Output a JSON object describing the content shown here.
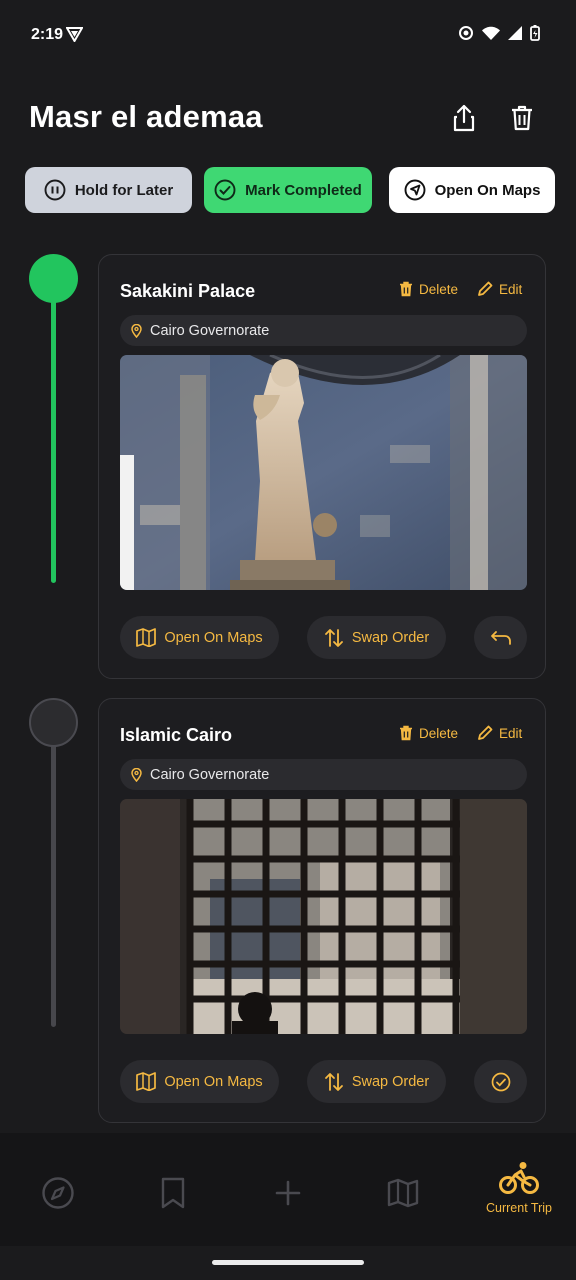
{
  "status": {
    "time": "2:19"
  },
  "header": {
    "title": "Masr el ademaa"
  },
  "actions": {
    "hold": "Hold for Later",
    "complete": "Mark Completed",
    "maps": "Open On Maps"
  },
  "stops": [
    {
      "title": "Sakakini Palace",
      "location": "Cairo Governorate",
      "delete_label": "Delete",
      "edit_label": "Edit",
      "maps_label": "Open On Maps",
      "swap_label": "Swap Order"
    },
    {
      "title": "Islamic Cairo",
      "location": "Cairo Governorate",
      "delete_label": "Delete",
      "edit_label": "Edit",
      "maps_label": "Open On Maps",
      "swap_label": "Swap Order"
    }
  ],
  "nav": {
    "current_label": "Current Trip"
  },
  "colors": {
    "accent": "#f5b942",
    "completed": "#3fd873",
    "active_timeline": "#22c55e",
    "background": "#1b1b1d"
  },
  "icons": [
    "explore-icon",
    "bookmark-icon",
    "add-icon",
    "map-icon",
    "bicycle-icon"
  ]
}
